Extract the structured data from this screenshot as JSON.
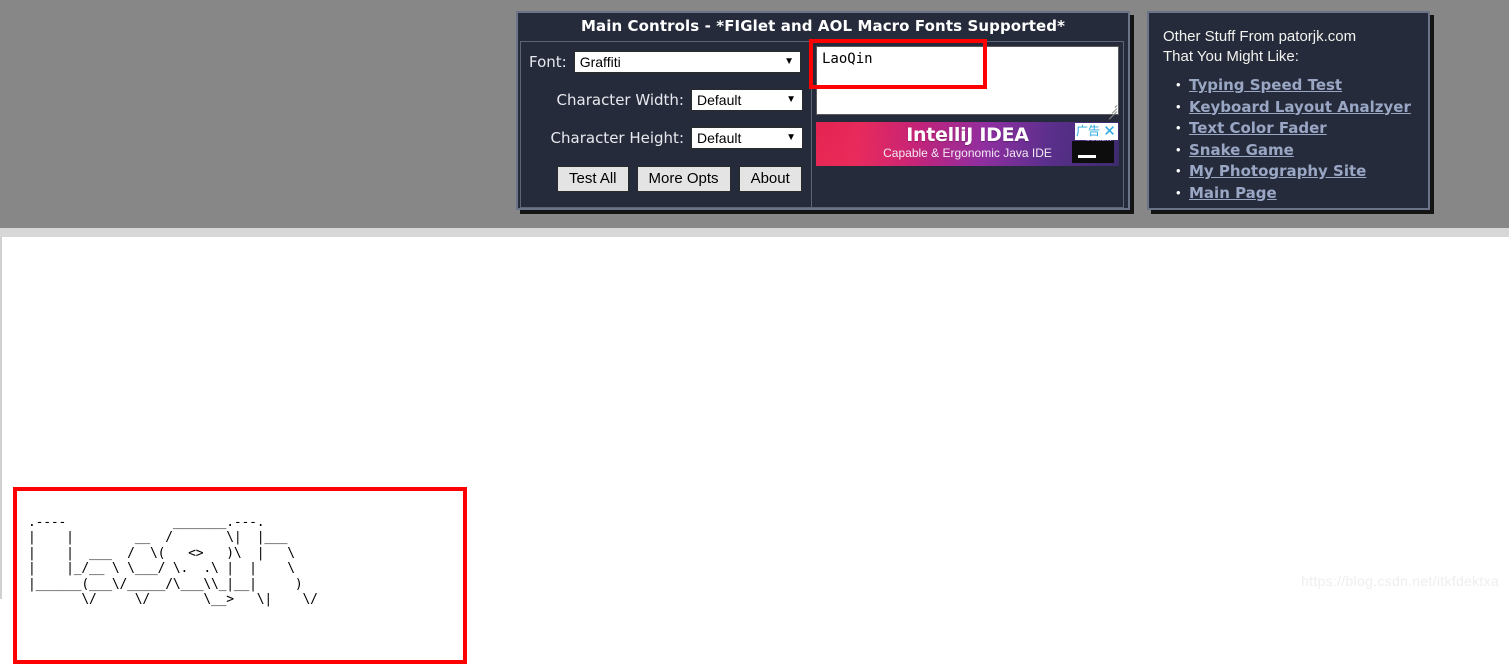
{
  "main_controls": {
    "title": "Main Controls - *FIGlet and AOL Macro Fonts Supported*",
    "font_label": "Font:",
    "font_value": "Graffiti",
    "char_width_label": "Character Width:",
    "char_width_value": "Default",
    "char_height_label": "Character Height:",
    "char_height_value": "Default",
    "dropdown_arrow": "▼",
    "buttons": [
      {
        "label": "Test All"
      },
      {
        "label": "More Opts"
      },
      {
        "label": "About"
      }
    ]
  },
  "input": {
    "value": "LaoQin",
    "placeholder": ""
  },
  "ad": {
    "title": "IntelliJ IDEA",
    "subtitle": "Capable & Ergonomic Java IDE",
    "brand_small": "JetBrains",
    "label": "广告",
    "close": "✕"
  },
  "sidebar": {
    "heading": "Other Stuff From patorjk.com\nThat You Might Like:",
    "links": [
      {
        "label": "Typing Speed Test"
      },
      {
        "label": "Keyboard Layout Analzyer"
      },
      {
        "label": "Text Color Fader"
      },
      {
        "label": "Snake Game"
      },
      {
        "label": "My Photography Site"
      },
      {
        "label": "Main Page"
      }
    ]
  },
  "output": {
    "ascii_art": ".----              _______.---.      \n|    |        __  /       \\|  |___     \n|    |  ___  /  \\(   <>   )\\  |   \\   \n|    |_/__ \\ \\___/ \\.  .\\ |  |    \\  \n|______(___\\/_____/\\___\\\\_|__|     )\n       \\/     \\/       \\__>   \\|    \\/ ",
    "accent_color": "#fe0000"
  },
  "watermark": {
    "text": "https://blog.csdn.net/itkfdektxa"
  },
  "theme": {
    "panel_bg": "#252b3b",
    "panel_border": "#6b7388",
    "page_gray": "#878787",
    "link_color": "#9aa7c4",
    "annotation_red": "#fe0000"
  }
}
